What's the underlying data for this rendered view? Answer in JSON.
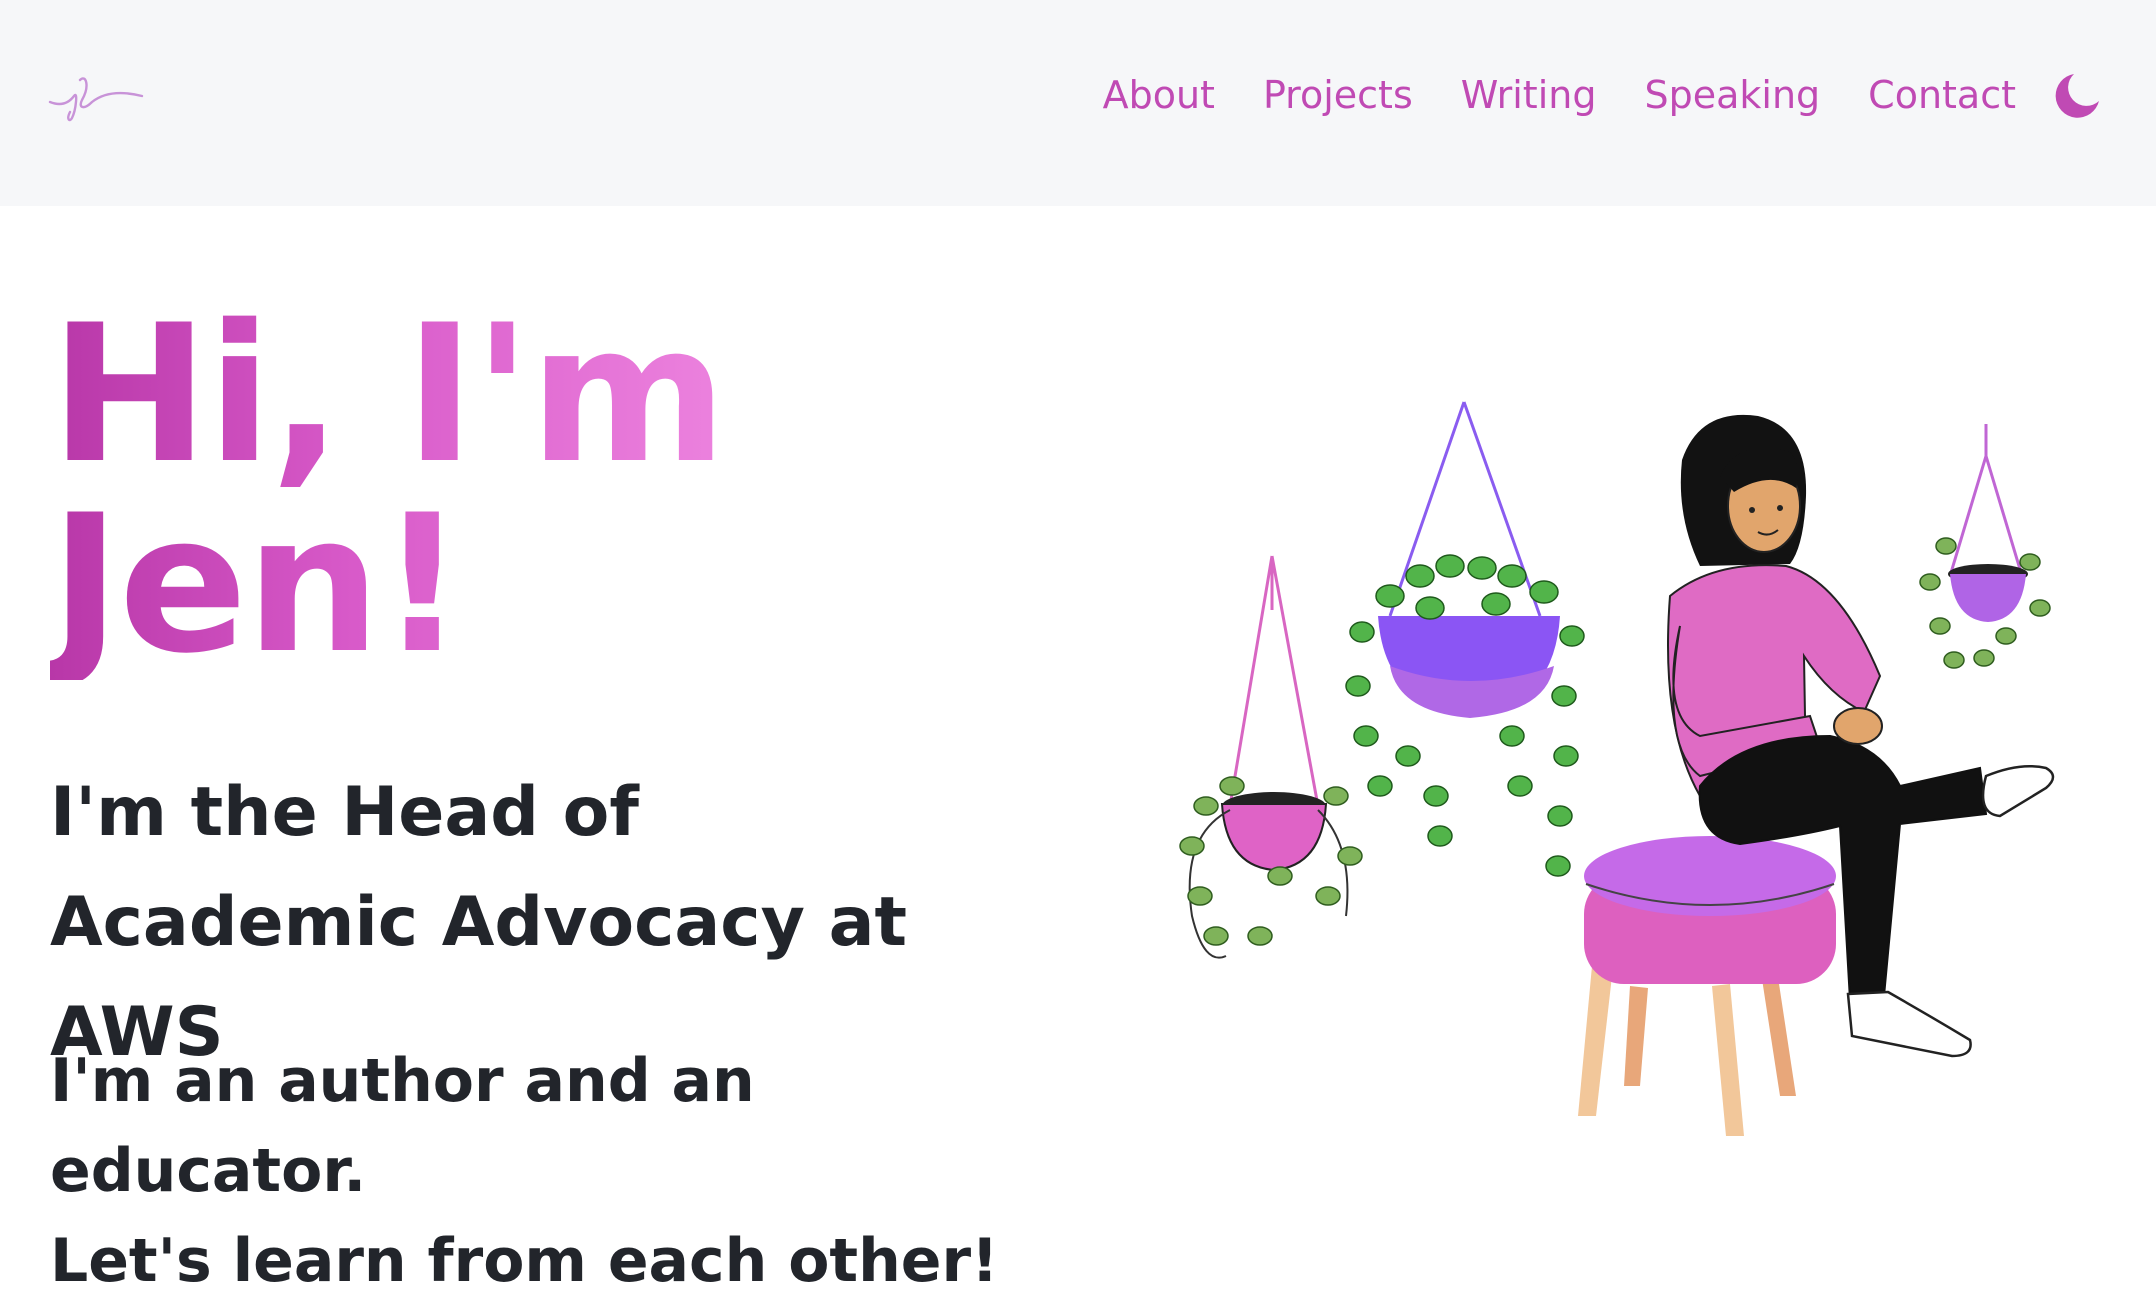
{
  "header": {
    "logo_text": "jl",
    "nav": [
      {
        "label": "About"
      },
      {
        "label": "Projects"
      },
      {
        "label": "Writing"
      },
      {
        "label": "Speaking"
      },
      {
        "label": "Contact"
      }
    ],
    "theme_toggle_icon": "moon-icon"
  },
  "hero": {
    "title_line1": "Hi, I'm",
    "title_line2": "Jen!",
    "subtitle": "I'm the Head of Academic Advocacy at AWS",
    "tagline_line1": "I'm an author and an educator.",
    "tagline_line2": "Let's learn from each other!"
  },
  "colors": {
    "accent": "#c04ab4",
    "gradient_start": "#b837a8",
    "gradient_end": "#ec82de",
    "text_dark": "#22252b",
    "header_bg": "#f6f7f9"
  }
}
